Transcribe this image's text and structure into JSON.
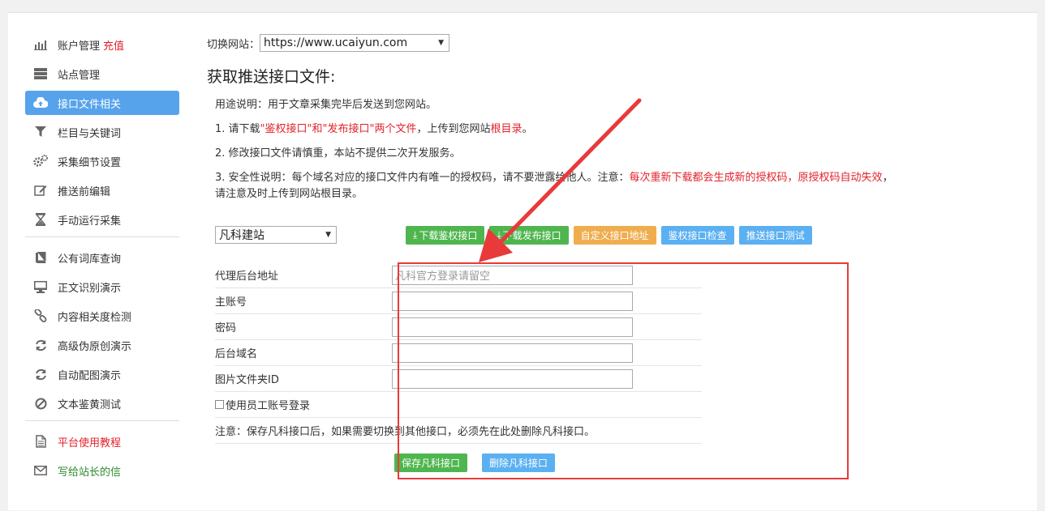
{
  "sidebar": {
    "items": [
      {
        "name": "account",
        "label": "账户管理",
        "extra": "充值",
        "icon": "bar-chart-icon"
      },
      {
        "name": "sites",
        "label": "站点管理",
        "icon": "server-icon"
      },
      {
        "name": "api-files",
        "label": "接口文件相关",
        "icon": "cloud-upload-icon",
        "active": true
      },
      {
        "name": "columns",
        "label": "栏目与关键词",
        "icon": "filter-icon"
      },
      {
        "name": "collect-settings",
        "label": "采集细节设置",
        "icon": "gears-icon"
      },
      {
        "name": "pre-push-edit",
        "label": "推送前编辑",
        "icon": "edit-icon"
      },
      {
        "name": "manual-run",
        "label": "手动运行采集",
        "icon": "hourglass-icon"
      }
    ],
    "items2": [
      {
        "name": "public-dict",
        "label": "公有词库查询",
        "icon": "book-icon"
      },
      {
        "name": "text-recognize",
        "label": "正文识别演示",
        "icon": "monitor-icon"
      },
      {
        "name": "relevance",
        "label": "内容相关度检测",
        "icon": "link-icon"
      },
      {
        "name": "pseudo-original",
        "label": "高级伪原创演示",
        "icon": "refresh-icon"
      },
      {
        "name": "auto-image",
        "label": "自动配图演示",
        "icon": "refresh-icon"
      },
      {
        "name": "porn-check",
        "label": "文本鉴黄测试",
        "icon": "ban-icon"
      }
    ],
    "items3": [
      {
        "name": "tutorial",
        "label": "平台使用教程",
        "icon": "file-icon"
      },
      {
        "name": "letter",
        "label": "写给站长的信",
        "icon": "envelope-icon"
      }
    ]
  },
  "main": {
    "site_label": "切换网站：",
    "site_value": "https://www.ucaiyun.com",
    "title": "获取推送接口文件:",
    "note_intro": "用途说明：用于文章采集完毕后发送到您网站。",
    "note1_a": "1. 请下载",
    "note1_b": "\"鉴权接口\"和\"发布接口\"两个文件",
    "note1_c": "，上传到您网站",
    "note1_d": "根目录",
    "note1_e": "。",
    "note2": "2. 修改接口文件请慎重，本站不提供二次开发服务。",
    "note3_a": "3. 安全性说明：每个域名对应的接口文件内有唯一的授权码，请不要泄露给他人。注意：",
    "note3_b": "每次重新下载都会生成新的授权码，原授权码自动失效",
    "note3_c": "，",
    "note3_d": "请注意及时上传到网站根目录。",
    "cms_value": "凡科建站",
    "buttons": {
      "download_auth": "下载鉴权接口",
      "download_publish": "下载发布接口",
      "custom_url": "自定义接口地址",
      "check_auth": "鉴权接口检查",
      "test_push": "推送接口测试"
    },
    "form": {
      "proxy_label": "代理后台地址",
      "proxy_placeholder": "凡科官方登录请留空",
      "account_label": "主账号",
      "password_label": "密码",
      "domain_label": "后台域名",
      "folder_label": "图片文件夹ID",
      "staff_login_label": "使用员工账号登录",
      "notice": "注意：保存凡科接口后，如果需要切换到其他接口，必须先在此处删除凡科接口。",
      "save_label": "保存凡科接口",
      "delete_label": "删除凡科接口"
    }
  },
  "colors": {
    "accent": "#56a3ec",
    "red": "#e3222a",
    "green_btn": "#4fb64f",
    "orange_btn": "#f0ad4e",
    "blue_btn": "#5bb0f2",
    "annotation": "#e83a3a"
  }
}
